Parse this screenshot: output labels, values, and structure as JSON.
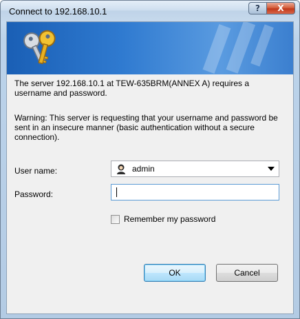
{
  "window": {
    "title": "Connect to 192.168.10.1",
    "help_glyph": "?",
    "close_glyph": "X"
  },
  "banner": {
    "icon": "keys-icon",
    "accent": "#2f7ad0"
  },
  "message": {
    "line1": "The server 192.168.10.1 at TEW-635BRM(ANNEX A) requires a username and password.",
    "line2": "Warning: This server is requesting that your username and password be sent in an insecure manner (basic authentication without a secure connection)."
  },
  "form": {
    "username_label": "User name:",
    "username_value": "admin",
    "password_label": "Password:",
    "password_value": "",
    "remember_label": "Remember my password",
    "remember_checked": false
  },
  "buttons": {
    "ok": "OK",
    "cancel": "Cancel"
  }
}
